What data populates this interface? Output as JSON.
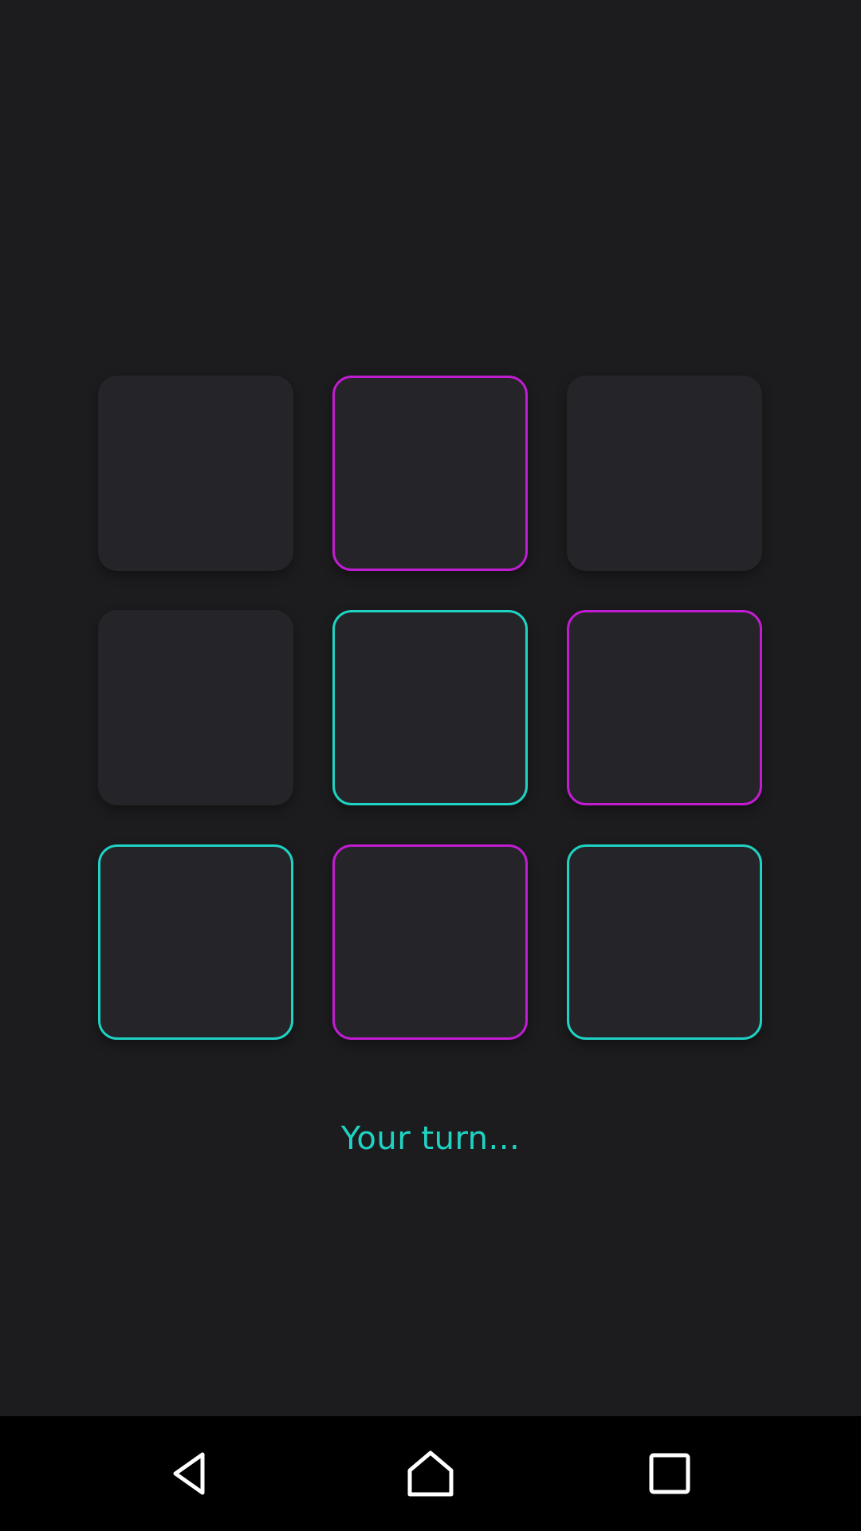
{
  "board": {
    "cells": [
      {
        "state": "empty"
      },
      {
        "state": "x"
      },
      {
        "state": "empty"
      },
      {
        "state": "empty"
      },
      {
        "state": "o"
      },
      {
        "state": "x"
      },
      {
        "state": "o"
      },
      {
        "state": "x"
      },
      {
        "state": "o"
      }
    ]
  },
  "status": {
    "text": "Your turn..."
  },
  "colors": {
    "background": "#1c1c1e",
    "cell": "#252529",
    "player_x": "#c21cd2",
    "player_o": "#1fd3c4",
    "navbar": "#000000"
  },
  "navbar": {
    "buttons": [
      {
        "icon": "back-icon"
      },
      {
        "icon": "home-icon"
      },
      {
        "icon": "recents-icon"
      }
    ]
  }
}
